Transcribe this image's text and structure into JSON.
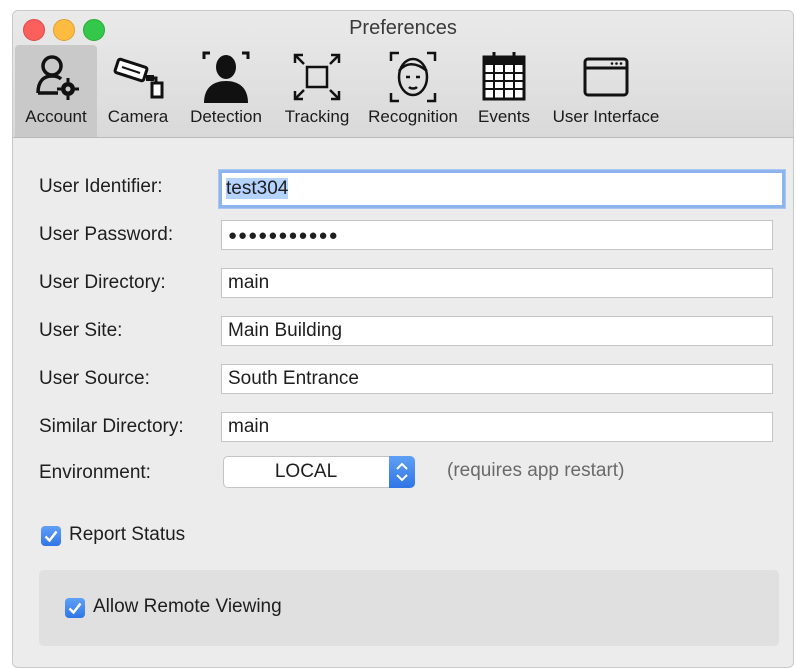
{
  "window": {
    "title": "Preferences"
  },
  "toolbar": {
    "tabs": [
      {
        "label": "Account",
        "icon": "account-settings-icon",
        "active": true
      },
      {
        "label": "Camera",
        "icon": "camera-icon",
        "active": false
      },
      {
        "label": "Detection",
        "icon": "person-detection-icon",
        "active": false
      },
      {
        "label": "Tracking",
        "icon": "tracking-icon",
        "active": false
      },
      {
        "label": "Recognition",
        "icon": "face-recognition-icon",
        "active": false
      },
      {
        "label": "Events",
        "icon": "calendar-icon",
        "active": false
      },
      {
        "label": "User Interface",
        "icon": "window-icon",
        "active": false
      }
    ]
  },
  "form": {
    "user_identifier": {
      "label": "User Identifier:",
      "value": "test304"
    },
    "user_password": {
      "label": "User Password:",
      "value": "●●●●●●●●●●●"
    },
    "user_directory": {
      "label": "User Directory:",
      "value": "main"
    },
    "user_site": {
      "label": "User Site:",
      "value": "Main Building"
    },
    "user_source": {
      "label": "User Source:",
      "value": "South Entrance"
    },
    "similar_directory": {
      "label": "Similar Directory:",
      "value": "main"
    },
    "environment": {
      "label": "Environment:",
      "value": "LOCAL",
      "hint": "(requires app restart)"
    }
  },
  "options": {
    "report_status": {
      "label": "Report Status",
      "checked": true
    },
    "allow_remote_viewing": {
      "label": "Allow Remote Viewing",
      "checked": true
    }
  },
  "colors": {
    "accent": "#2f75e6",
    "focus_ring": "#8db4ec",
    "selection": "#b5d3ff"
  }
}
